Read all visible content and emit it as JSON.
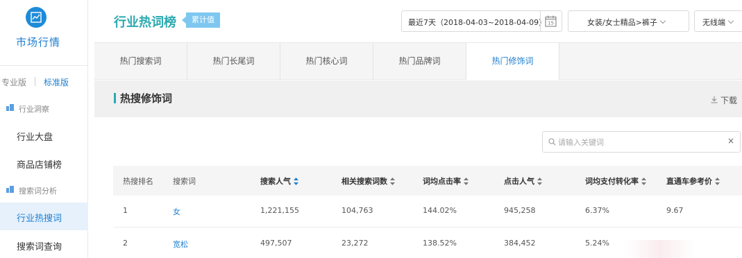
{
  "sidebar": {
    "title": "市场行情",
    "version_pro": "专业版",
    "version_std": "标准版",
    "sections": [
      {
        "label": "行业洞察",
        "items": [
          "行业大盘",
          "商品店铺榜"
        ]
      },
      {
        "label": "搜索词分析",
        "items": [
          "行业热搜词",
          "搜索词查询"
        ]
      }
    ],
    "active_item": "行业热搜词"
  },
  "header": {
    "title": "行业热词榜",
    "badge": "累计值",
    "date_range": "最近7天（2018-04-03~2018-04-09）",
    "calendar_day": "15",
    "category": "女装/女士精品>裤子",
    "device": "无线端"
  },
  "tabs": [
    {
      "label": "热门搜索词",
      "active": false
    },
    {
      "label": "热门长尾词",
      "active": false
    },
    {
      "label": "热门核心词",
      "active": false
    },
    {
      "label": "热门品牌词",
      "active": false
    },
    {
      "label": "热门修饰词",
      "active": true
    }
  ],
  "section": {
    "title": "热搜修饰词",
    "download": "下载"
  },
  "search": {
    "placeholder": "请输入关键词",
    "clear": "×"
  },
  "table": {
    "columns": [
      "热搜排名",
      "搜索词",
      "搜索人气",
      "相关搜索词数",
      "词均点击率",
      "点击人气",
      "词均支付转化率",
      "直通车参考价"
    ],
    "rows": [
      [
        "1",
        "女",
        "1,221,155",
        "104,763",
        "144.02%",
        "945,258",
        "6.37%",
        "9.67"
      ],
      [
        "2",
        "宽松",
        "497,507",
        "23,272",
        "138.52%",
        "384,452",
        "5.24%",
        ""
      ]
    ]
  },
  "colors": {
    "accent": "#1e7fd0",
    "title_teal": "#2aa9b0",
    "badge_blue": "#7ec7f0"
  }
}
